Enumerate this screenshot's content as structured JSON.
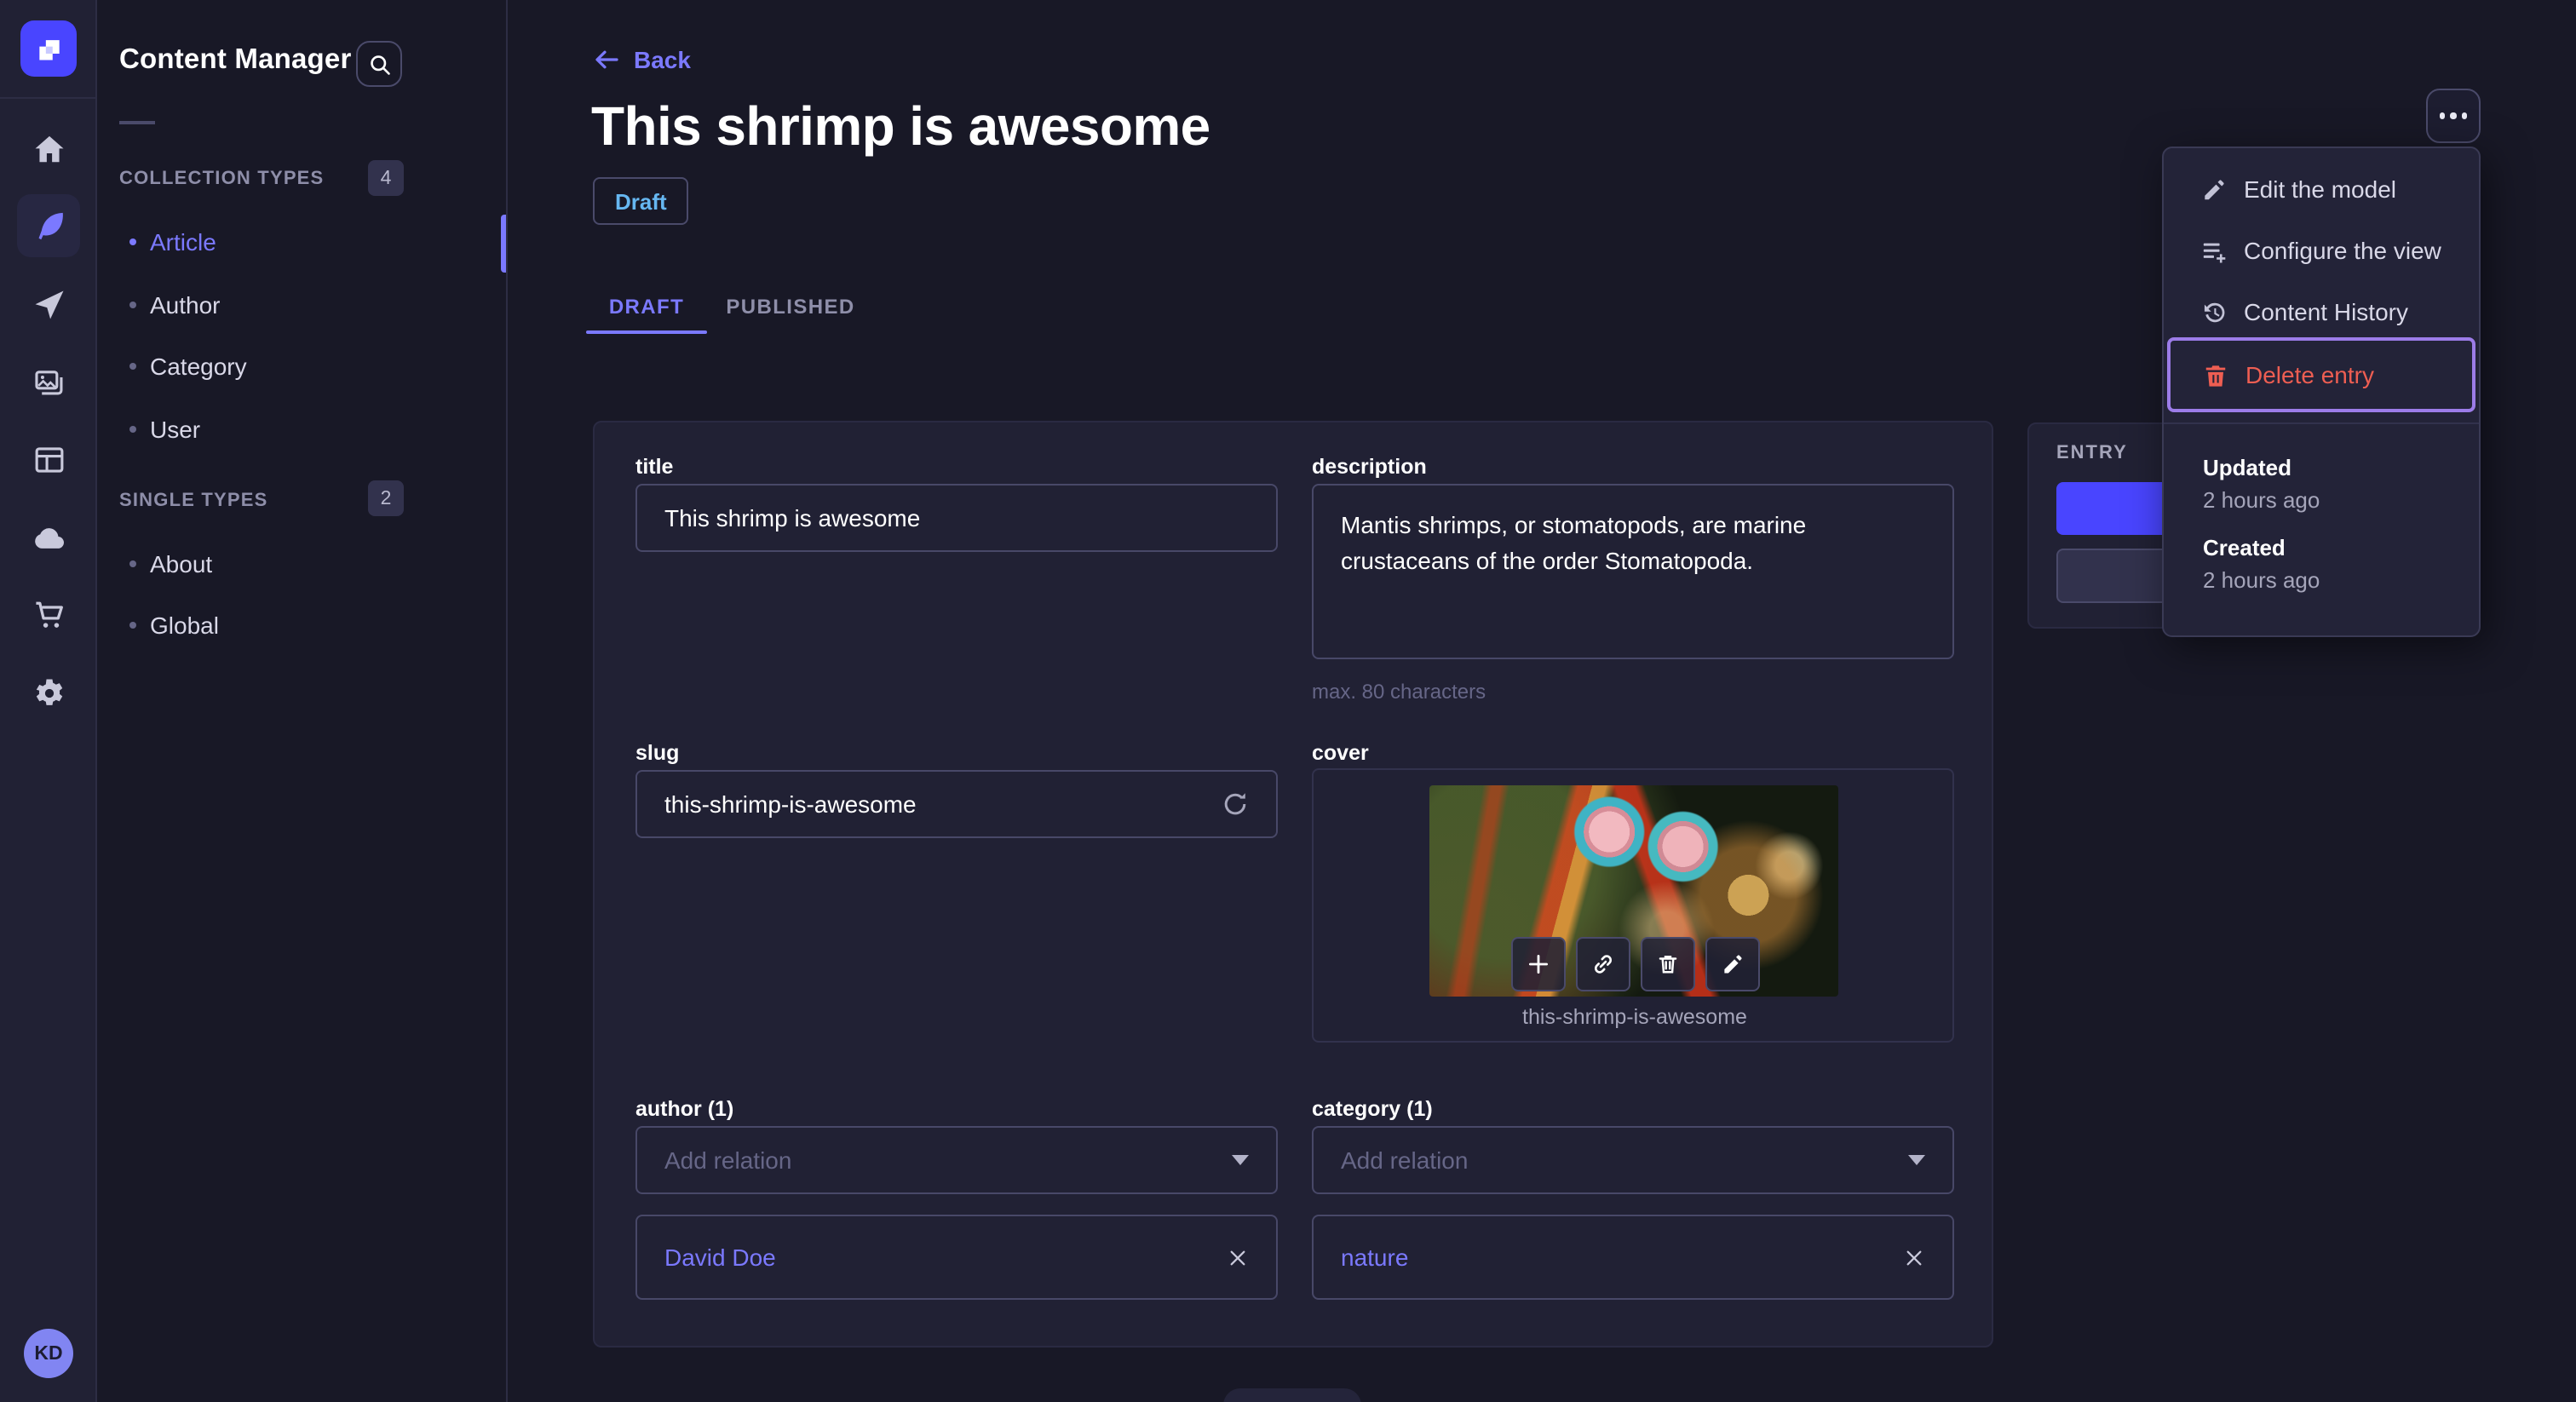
{
  "colors": {
    "accent": "#4945ff",
    "link": "#7b79ff",
    "danger": "#ee5e52",
    "status_draft": "#66b7f1"
  },
  "nav": {
    "avatar_initials": "KD"
  },
  "subnav": {
    "title": "Content Manager",
    "sections": [
      {
        "label": "COLLECTION TYPES",
        "count": "4",
        "items": [
          {
            "label": "Article"
          },
          {
            "label": "Author"
          },
          {
            "label": "Category"
          },
          {
            "label": "User"
          }
        ]
      },
      {
        "label": "SINGLE TYPES",
        "count": "2",
        "items": [
          {
            "label": "About"
          },
          {
            "label": "Global"
          }
        ]
      }
    ]
  },
  "header": {
    "back_label": "Back",
    "title": "This shrimp is awesome",
    "status": "Draft",
    "tabs": [
      {
        "label": "DRAFT"
      },
      {
        "label": "PUBLISHED"
      }
    ]
  },
  "form": {
    "title": {
      "label": "title",
      "value": "This shrimp is awesome"
    },
    "description": {
      "label": "description",
      "value": "Mantis shrimps, or stomatopods, are marine crustaceans of the order Stomatopoda.",
      "helper": "max. 80 characters"
    },
    "slug": {
      "label": "slug",
      "value": "this-shrimp-is-awesome"
    },
    "cover": {
      "label": "cover",
      "caption": "this-shrimp-is-awesome"
    },
    "author": {
      "label": "author (1)",
      "placeholder": "Add relation",
      "relation": "David Doe"
    },
    "category": {
      "label": "category (1)",
      "placeholder": "Add relation",
      "relation": "nature"
    }
  },
  "entry_panel": {
    "label": "ENTRY"
  },
  "context_menu": {
    "items": [
      {
        "label": "Edit the model"
      },
      {
        "label": "Configure the view"
      },
      {
        "label": "Content History"
      },
      {
        "label": "Delete entry"
      }
    ],
    "meta": [
      {
        "label": "Updated",
        "value": "2 hours ago"
      },
      {
        "label": "Created",
        "value": "2 hours ago"
      }
    ]
  }
}
